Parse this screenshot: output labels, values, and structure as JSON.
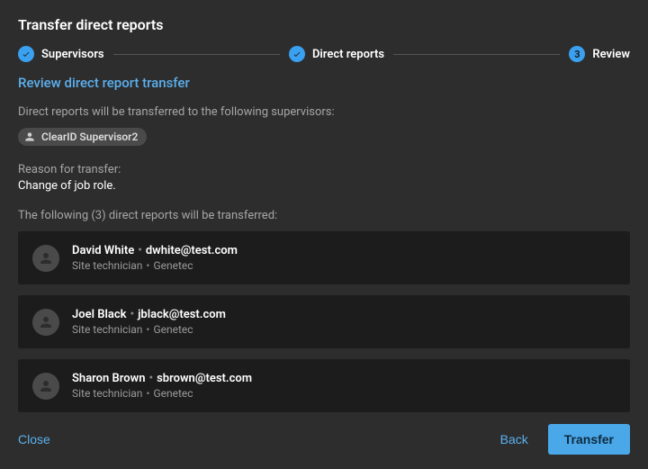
{
  "title": "Transfer direct reports",
  "stepper": {
    "steps": [
      {
        "label": "Supervisors",
        "state": "done"
      },
      {
        "label": "Direct reports",
        "state": "done"
      },
      {
        "label": "Review",
        "state": "current",
        "number": "3"
      }
    ]
  },
  "review": {
    "heading": "Review direct report transfer",
    "supervisors_intro": "Direct reports will be transferred to the following supervisors:",
    "supervisor_chip": "ClearID Supervisor2",
    "reason_label": "Reason for transfer:",
    "reason_value": "Change of job role.",
    "list_intro": "The following (3) direct reports will be transferred:",
    "people": [
      {
        "name": "David White",
        "email": "dwhite@test.com",
        "role": "Site technician",
        "org": "Genetec"
      },
      {
        "name": "Joel Black",
        "email": "jblack@test.com",
        "role": "Site technician",
        "org": "Genetec"
      },
      {
        "name": "Sharon Brown",
        "email": "sbrown@test.com",
        "role": "Site technician",
        "org": "Genetec"
      }
    ]
  },
  "footer": {
    "close": "Close",
    "back": "Back",
    "transfer": "Transfer"
  }
}
